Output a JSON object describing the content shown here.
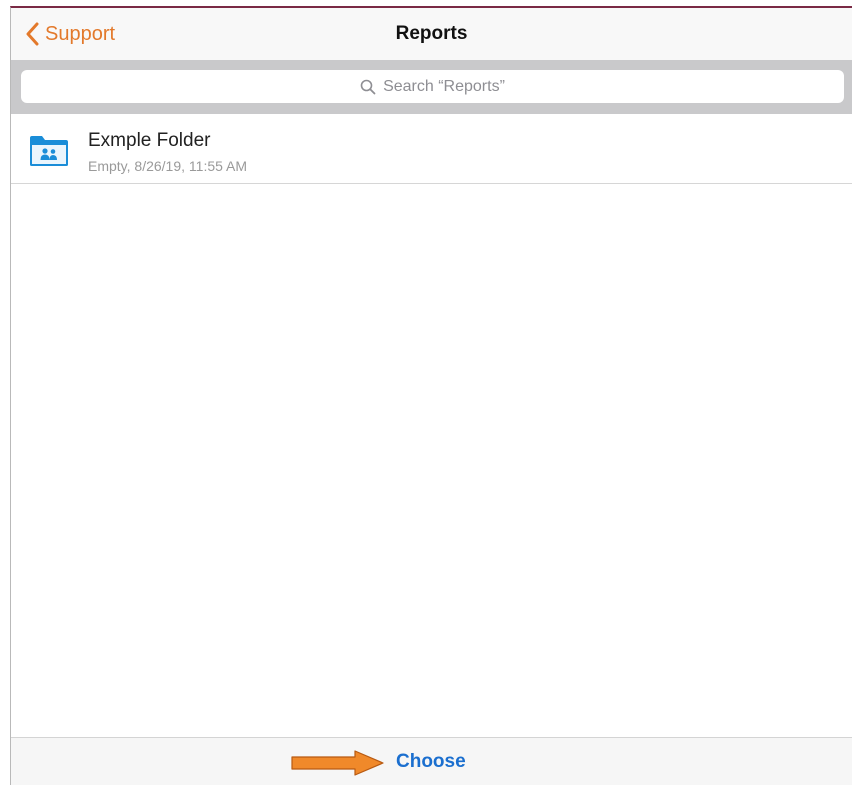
{
  "navbar": {
    "back_label": "Support",
    "title": "Reports"
  },
  "search": {
    "placeholder": "Search “Reports”"
  },
  "files": [
    {
      "name": "Exmple Folder",
      "subtitle": "Empty, 8/26/19, 11:55 AM",
      "icon": "shared-folder-icon"
    }
  ],
  "toolbar": {
    "choose_label": "Choose",
    "annotation_icon": "orange-arrow-icon"
  },
  "colors": {
    "accent_orange": "#e3792b",
    "link_blue": "#1b6fcf",
    "folder_blue": "#1a8dd8",
    "arrow_orange": "#f0892a",
    "top_border": "#7a2a45"
  }
}
